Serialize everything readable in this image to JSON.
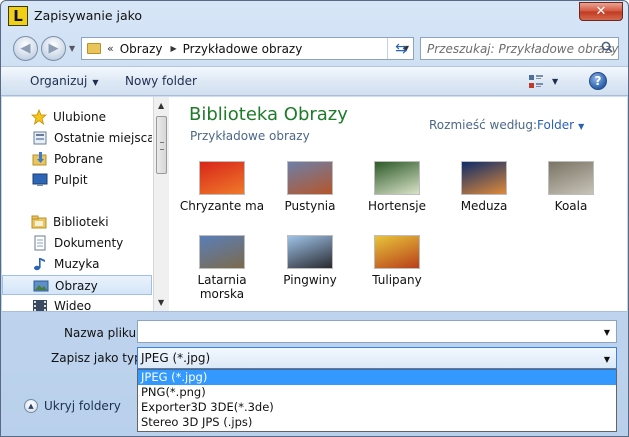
{
  "window": {
    "title": "Zapisywanie jako",
    "app_icon_letter": "L",
    "close_glyph": "✕"
  },
  "address": {
    "prefix": "«",
    "crumbs": [
      "Obrazy",
      "Przykładowe obrazy"
    ],
    "search_placeholder": "Przeszukaj: Przykładowe obrazy"
  },
  "toolbar": {
    "organize": "Organizuj",
    "new_folder": "Nowy folder",
    "help": "?"
  },
  "nav": {
    "items": [
      {
        "label": "Ulubione",
        "icon": "star-icon"
      },
      {
        "label": "Ostatnie miejsca",
        "icon": "recent-places-icon"
      },
      {
        "label": "Pobrane",
        "icon": "downloads-icon"
      },
      {
        "label": "Pulpit",
        "icon": "desktop-icon"
      },
      {
        "label": "Biblioteki",
        "icon": "libraries-icon"
      },
      {
        "label": "Dokumenty",
        "icon": "documents-icon"
      },
      {
        "label": "Muzyka",
        "icon": "music-icon"
      },
      {
        "label": "Obrazy",
        "icon": "pictures-icon",
        "selected": true
      },
      {
        "label": "Wideo",
        "icon": "video-icon"
      }
    ]
  },
  "library": {
    "title": "Biblioteka Obrazy",
    "subtitle": "Przykładowe obrazy",
    "arrange_label": "Rozmieść według:",
    "arrange_value": "Folder"
  },
  "files": [
    {
      "name": "Chryzante ma",
      "colors": [
        "#d8261a",
        "#f07a2a"
      ]
    },
    {
      "name": "Pustynia",
      "colors": [
        "#6d7fa8",
        "#b5562a"
      ]
    },
    {
      "name": "Hortensje",
      "colors": [
        "#2e5a2a",
        "#d9e3c8"
      ]
    },
    {
      "name": "Meduza",
      "colors": [
        "#0e2c6a",
        "#e08a3a"
      ]
    },
    {
      "name": "Koala",
      "colors": [
        "#7a7465",
        "#c8c3b8"
      ]
    },
    {
      "name": "Latarnia morska",
      "colors": [
        "#5a7fb8",
        "#7c6a4c"
      ]
    },
    {
      "name": "Pingwiny",
      "colors": [
        "#9ec3e8",
        "#2a2a30"
      ]
    },
    {
      "name": "Tulipany",
      "colors": [
        "#e8c43a",
        "#b8401a"
      ]
    }
  ],
  "form": {
    "filename_label": "Nazwa pliku:",
    "filename_value": "",
    "filetype_label": "Zapisz jako typ:",
    "filetype_value": "JPEG (*.jpg)",
    "filetype_options": [
      "JPEG (*.jpg)",
      "PNG(*.png)",
      "Exporter3D 3DE(*.3de)",
      "Stereo 3D JPS (.jps)"
    ]
  },
  "footer": {
    "hide_folders": "Ukryj foldery"
  },
  "colors": {
    "accent_title": "#1e7b2a",
    "selection": "#3399ff",
    "link": "#2a62b5"
  }
}
